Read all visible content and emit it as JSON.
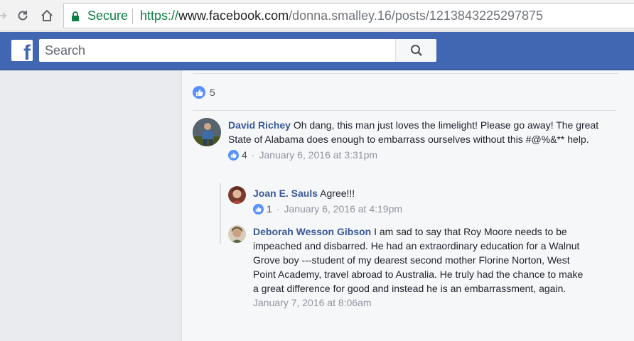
{
  "browser": {
    "secure_label": "Secure",
    "url_scheme": "https://",
    "url_host": "www.facebook.com",
    "url_path": "/donna.smalley.16/posts/1213843225297875"
  },
  "header": {
    "logo": "f",
    "search_placeholder": "Search"
  },
  "post": {
    "like_count": "5",
    "comments": [
      {
        "author": "David Richey",
        "text": "Oh dang, this man just loves the limelight! Please go away! The great State of Alabama does enough to embarrass ourselves without this #@%&** help.",
        "likes": "4",
        "separator": "·",
        "time": "January 6, 2016 at 3:31pm",
        "replies": [
          {
            "author": "Joan E. Sauls",
            "text": "Agree!!!",
            "likes": "1",
            "separator": "·",
            "time": "January 6, 2016 at 4:19pm"
          },
          {
            "author": "Deborah Wesson Gibson",
            "text": "I am sad to say that Roy Moore needs to be impeached and disbarred. He had an extraordinary education for a Walnut Grove boy ---student of my dearest second mother Florine Norton, West Point Academy, travel abroad to Australia. He truly had the chance to make a great difference for good and instead he is an embarrassment, again.",
            "time": "January 7, 2016 at 8:06am"
          }
        ]
      }
    ]
  }
}
